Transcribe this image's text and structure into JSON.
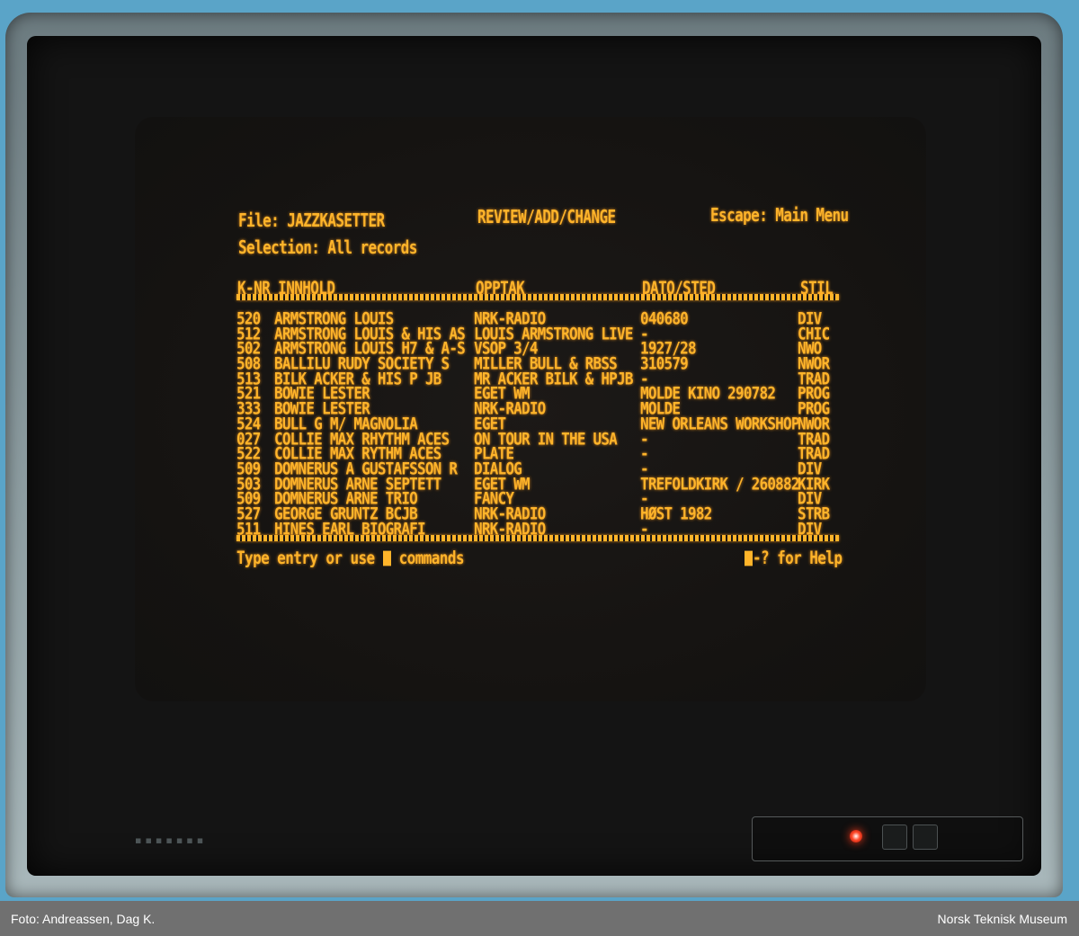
{
  "screen": {
    "file_label": "File: JAZZKASETTER",
    "mode_label": "REVIEW/ADD/CHANGE",
    "escape_label": "Escape: Main Menu",
    "selection_label": "Selection: All records",
    "columns": {
      "knr_innhold": "K-NR INNHOLD",
      "opptak": "OPPTAK",
      "dato_sted": "DATO/STED",
      "stil": "STIL"
    },
    "records": [
      {
        "knr": "520",
        "innhold": "ARMSTRONG LOUIS",
        "opptak": "NRK-RADIO",
        "dato": "040680",
        "stil": "DIV"
      },
      {
        "knr": "512",
        "innhold": "ARMSTRONG LOUIS & HIS AS",
        "opptak": "LOUIS ARMSTRONG LIVE",
        "dato": "-",
        "stil": "CHIC"
      },
      {
        "knr": "502",
        "innhold": "ARMSTRONG LOUIS H7 & A-S",
        "opptak": "VSOP 3/4",
        "dato": "1927/28",
        "stil": "NWO"
      },
      {
        "knr": "508",
        "innhold": "BALLILU RUDY SOCIETY S",
        "opptak": "MILLER BULL & RBSS",
        "dato": "310579",
        "stil": "NWOR"
      },
      {
        "knr": "513",
        "innhold": "BILK ACKER & HIS P JB",
        "opptak": "MR ACKER BILK & HPJB",
        "dato": "-",
        "stil": "TRAD"
      },
      {
        "knr": "521",
        "innhold": "BOWIE LESTER",
        "opptak": "EGET WM",
        "dato": "MOLDE KINO 290782",
        "stil": "PROG"
      },
      {
        "knr": "333",
        "innhold": "BOWIE LESTER",
        "opptak": "NRK-RADIO",
        "dato": "MOLDE",
        "stil": "PROG"
      },
      {
        "knr": "524",
        "innhold": "BULL G M/ MAGNOLIA",
        "opptak": "EGET",
        "dato": "NEW ORLEANS WORKSHOP",
        "stil": "NWOR"
      },
      {
        "knr": "027",
        "innhold": "COLLIE MAX RHYTHM ACES",
        "opptak": "ON TOUR IN THE USA",
        "dato": "-",
        "stil": "TRAD"
      },
      {
        "knr": "522",
        "innhold": "COLLIE MAX RYTHM ACES",
        "opptak": "PLATE",
        "dato": "-",
        "stil": "TRAD"
      },
      {
        "knr": "509",
        "innhold": "DOMNERUS A GUSTAFSSON R",
        "opptak": "DIALOG",
        "dato": "-",
        "stil": "DIV"
      },
      {
        "knr": "503",
        "innhold": "DOMNERUS ARNE SEPTETT",
        "opptak": "EGET WM",
        "dato": "TREFOLDKIRK / 260882",
        "stil": "KIRK"
      },
      {
        "knr": "509",
        "innhold": "DOMNERUS ARNE TRIO",
        "opptak": "FANCY",
        "dato": "-",
        "stil": "DIV"
      },
      {
        "knr": "527",
        "innhold": "GEORGE GRUNTZ BCJB",
        "opptak": "NRK-RADIO",
        "dato": "HØST 1982",
        "stil": "STRB"
      },
      {
        "knr": "511",
        "innhold": "HINES EARL BIOGRAFI",
        "opptak": "NRK-RADIO",
        "dato": "-",
        "stil": "DIV"
      }
    ],
    "footer_left_a": "Type entry or use ",
    "footer_left_b": " commands",
    "footer_right": "-? for Help"
  },
  "caption": {
    "credit": "Foto: Andreassen, Dag K.",
    "museum": "Norsk Teknisk Museum"
  },
  "colors": {
    "phosphor": "#ffb42a",
    "screen": "#141414",
    "caption_bar": "#707070",
    "led": "#ff3a1a"
  }
}
